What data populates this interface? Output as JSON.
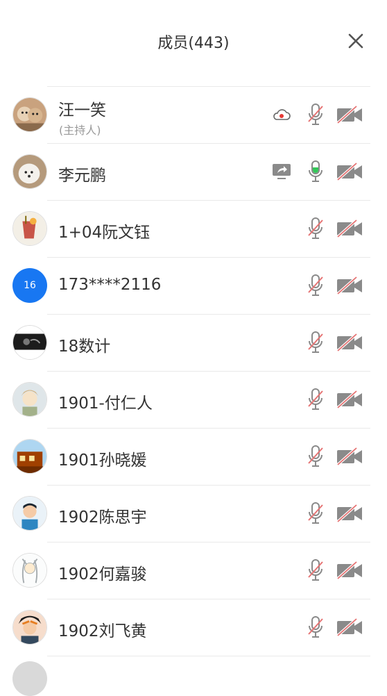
{
  "header": {
    "title": "成员(443)",
    "close_icon": "close-icon"
  },
  "colors": {
    "muted_slash": "#e57373",
    "mic_level_green": "#34c759",
    "record_dot": "#e53935",
    "initials_avatar": "#1877f2"
  },
  "members": [
    {
      "name": "汪一笑",
      "sub": "(主持人)",
      "avatar": "photo",
      "status_icon": "recording-icon",
      "mic": "muted",
      "camera": "off"
    },
    {
      "name": "李元鹏",
      "avatar": "photo",
      "status_icon": "screen-share-icon",
      "mic": "active",
      "camera": "off"
    },
    {
      "name": "1+04阮文钰",
      "avatar": "photo",
      "mic": "muted",
      "camera": "off"
    },
    {
      "name": "173****2116",
      "avatar": "initials",
      "initials": "16",
      "mic": "muted",
      "camera": "off"
    },
    {
      "name": "18数计",
      "avatar": "photo",
      "mic": "muted",
      "camera": "off"
    },
    {
      "name": "1901-付仁人",
      "avatar": "photo",
      "mic": "muted",
      "camera": "off"
    },
    {
      "name": "1901孙晓媛",
      "avatar": "photo",
      "mic": "muted",
      "camera": "off"
    },
    {
      "name": "1902陈思宇",
      "avatar": "photo",
      "mic": "muted",
      "camera": "off"
    },
    {
      "name": "1902何嘉骏",
      "avatar": "photo",
      "mic": "muted",
      "camera": "off"
    },
    {
      "name": "1902刘飞黄",
      "avatar": "photo",
      "mic": "muted",
      "camera": "off"
    }
  ]
}
